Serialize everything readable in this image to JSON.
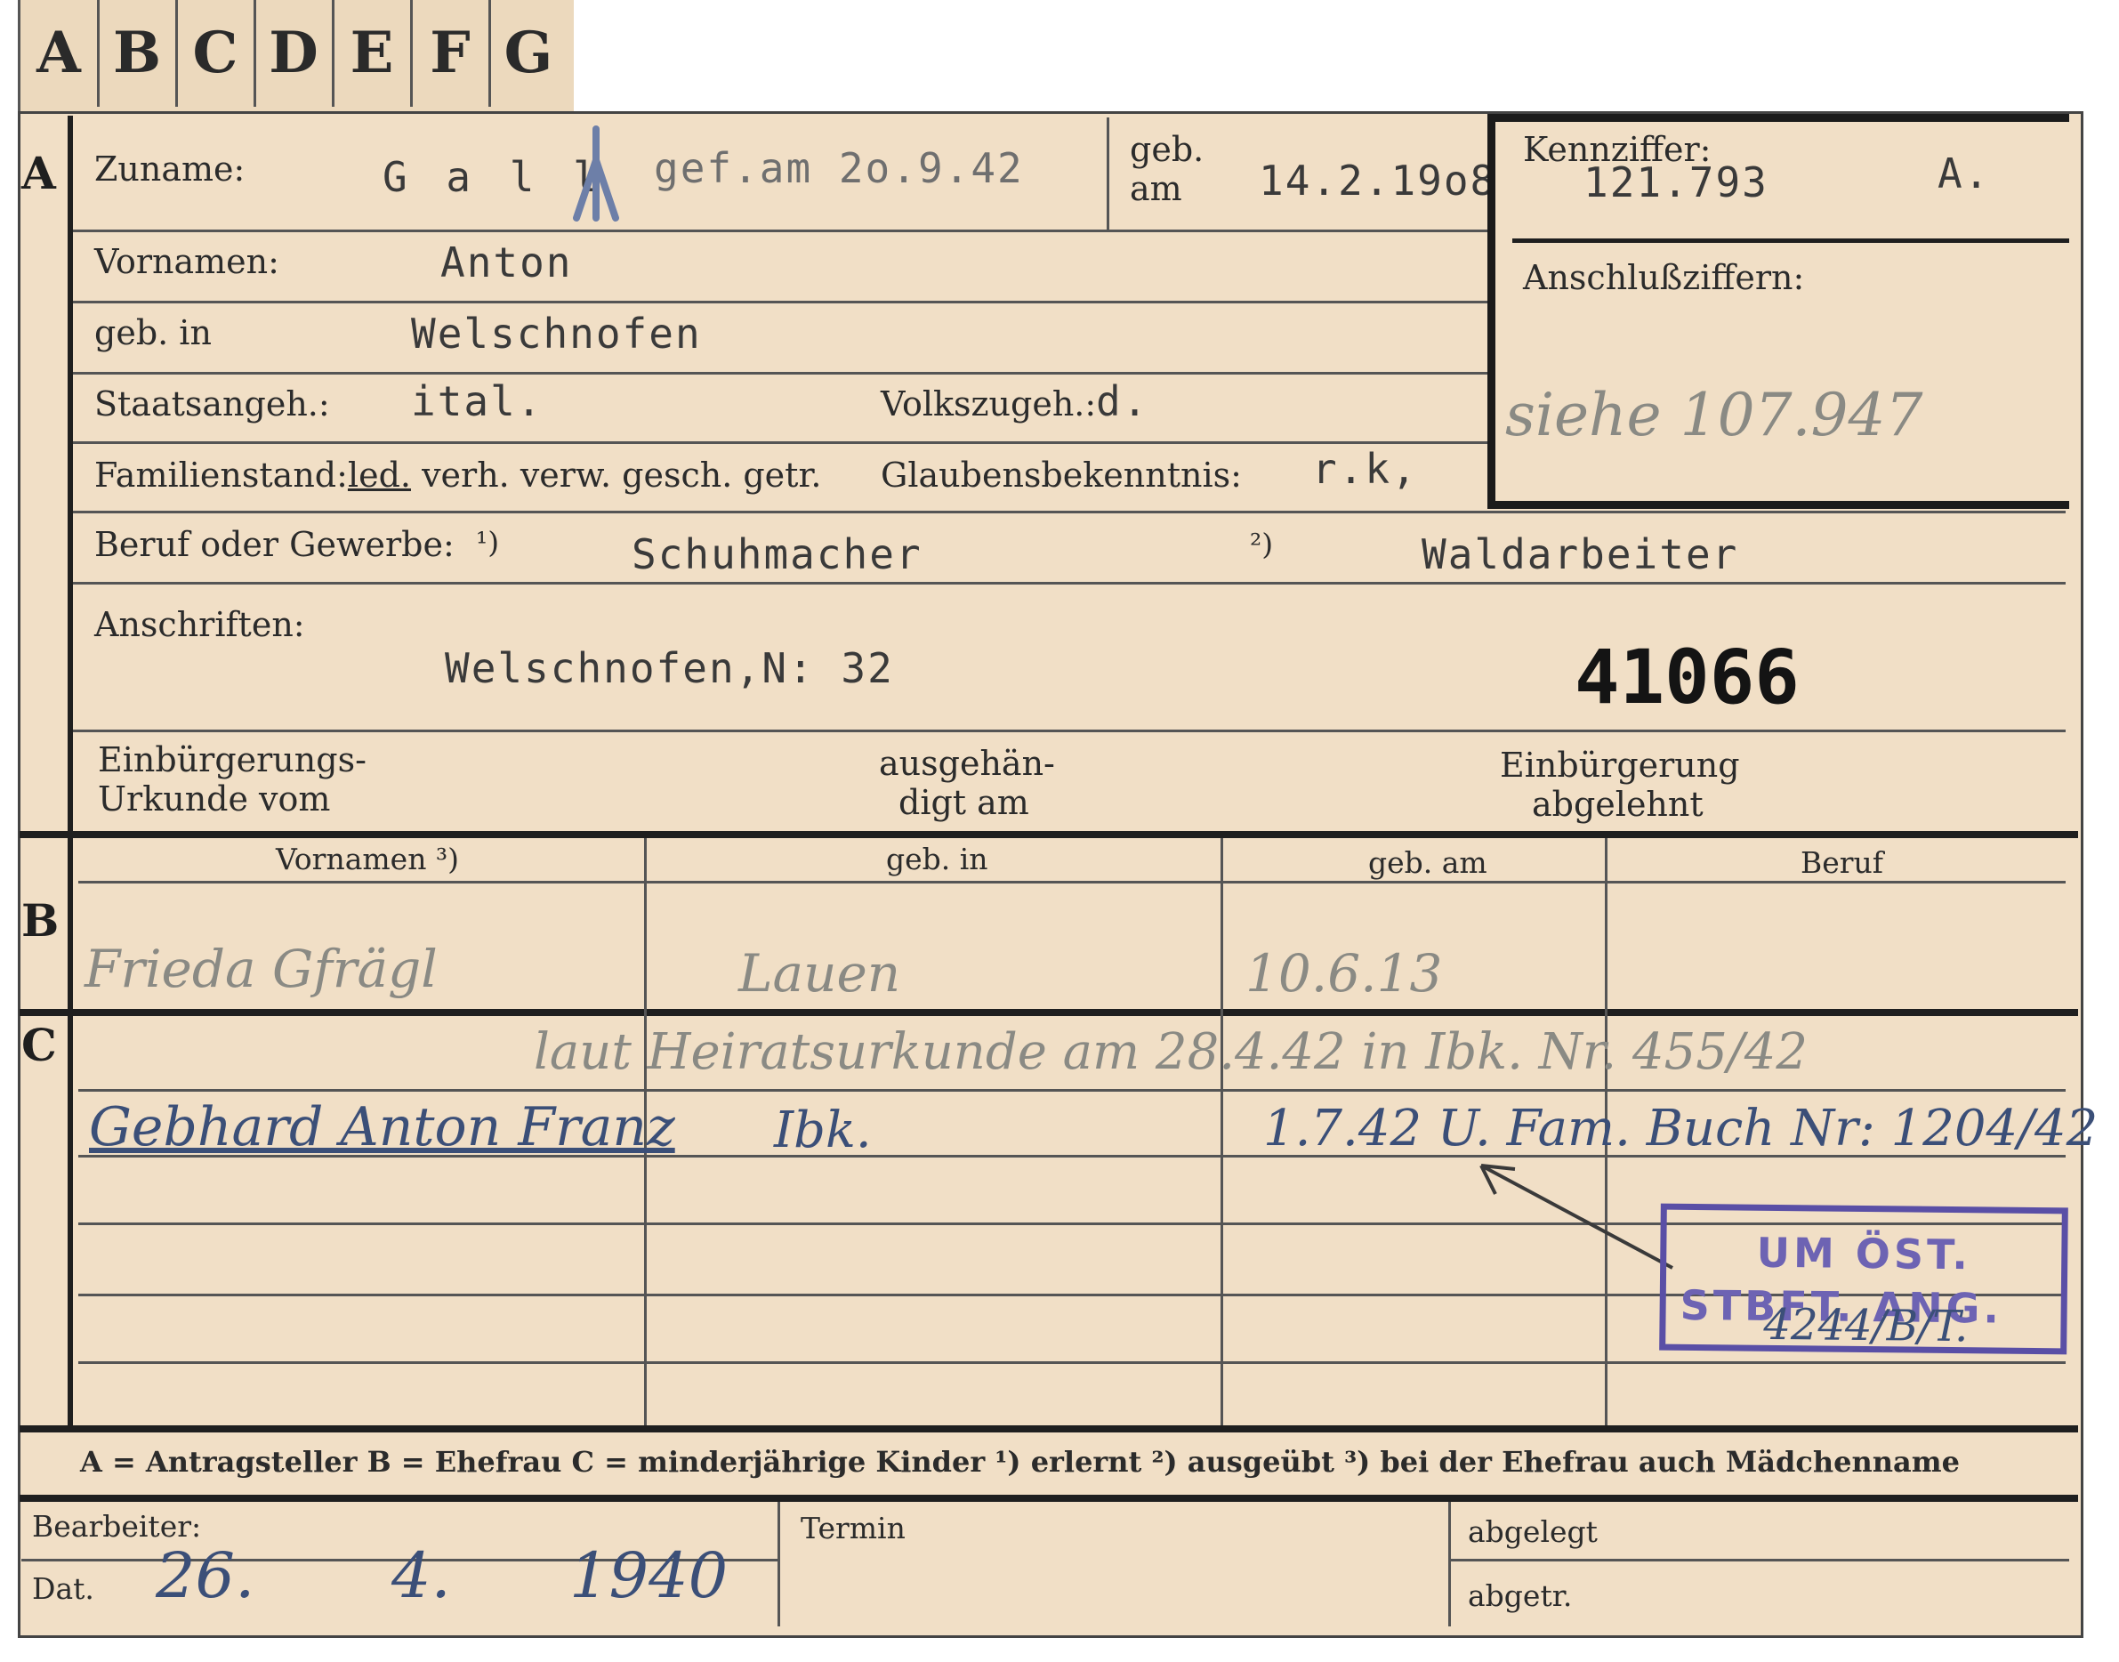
{
  "tabs": [
    "A",
    "B",
    "C",
    "D",
    "E",
    "F",
    "G"
  ],
  "sections": {
    "a": "A",
    "b": "B",
    "c": "C"
  },
  "section_a": {
    "surname_label": "Zuname:",
    "surname_value": "G a l l",
    "fallen_note": "gef.am 2o.9.42",
    "born_on_label_1": "geb.",
    "born_on_label_2": "am",
    "born_on_value": "14.2.19o8",
    "first_names_label": "Vornamen:",
    "first_names_value": "Anton",
    "born_in_label": "geb. in",
    "born_in_value": "Welschnofen",
    "citizenship_label": "Staatsangeh.:",
    "citizenship_value": "ital.",
    "ethnicity_label": "Volkszugeh.:",
    "ethnicity_value": "d.",
    "marital_label_marked": "led.",
    "marital_label_rest": "verh. verw. gesch. getr.",
    "marital_label_prefix": "Familienstand:",
    "religion_label": "Glaubensbekenntnis:",
    "religion_value": "r.k,",
    "profession_label": "Beruf oder Gewerbe:",
    "profession_note_1": "¹)",
    "profession_value_1": "Schuhmacher",
    "profession_note_2": "²)",
    "profession_value_2": "Waldarbeiter",
    "address_label": "Anschriften:",
    "address_value": "Welschnofen,N: 32",
    "file_number": "41066",
    "naturalization_label_1": "Einbürgerungs-",
    "naturalization_label_2": "Urkunde vom",
    "handed_label_1": "ausgehän-",
    "handed_label_2": "digt am",
    "rejected_label_1": "Einbürgerung",
    "rejected_label_2": "abgelehnt"
  },
  "reference_box": {
    "id_label": "Kennziffer:",
    "id_value": "121.793",
    "id_suffix": "A.",
    "linked_label": "Anschlußziffern:",
    "linked_value": "siehe 107.947"
  },
  "section_b": {
    "headers": [
      "Vornamen ³)",
      "geb. in",
      "geb. am",
      "Beruf"
    ],
    "row": {
      "first_names": "Frieda Gfrägl",
      "born_in": "Lauen",
      "born_on": "10.6.13"
    }
  },
  "section_c": {
    "note": "laut Heiratsurkunde am 28.4.42 in Ibk. Nr. 455/42",
    "child_name": "Gebhard Anton Franz",
    "child_place": "Ibk.",
    "child_entry": "1.7.42 U. Fam. Buch Nr: 1204/42",
    "stamp_line_1": "UM ÖST.",
    "stamp_line_2": "STBFT. ANG.",
    "stamp_ref": "4244/B/T."
  },
  "legend": {
    "text": "A = Antragsteller   B = Ehefrau   C = minderjährige Kinder   ¹) erlernt   ²) ausgeübt   ³) bei der Ehefrau auch Mädchenname"
  },
  "footer": {
    "processor_label": "Bearbeiter:",
    "date_label": "Dat.",
    "date_day": "26.",
    "date_month": "4.",
    "date_year": "1940",
    "deadline_label": "Termin",
    "filed_label": "abgelegt",
    "sent_label": "abgetr."
  },
  "colors": {
    "card": "#f1dfc6",
    "tabs": "#ecd9bd",
    "background": "#ffffff",
    "stamp": "#5a4fa6",
    "ink": "#3b4f78",
    "pencil": "#8a8a84"
  }
}
